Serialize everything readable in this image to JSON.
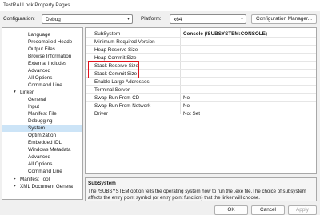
{
  "window": {
    "title": "TestRAIILock Property Pages"
  },
  "config": {
    "configuration_label": "Configuration:",
    "configuration_value": "Debug",
    "platform_label": "Platform:",
    "platform_value": "x64",
    "manager_button": "Configuration Manager..."
  },
  "tree": {
    "items": [
      {
        "label": "Language"
      },
      {
        "label": "Precompiled Heade"
      },
      {
        "label": "Output Files"
      },
      {
        "label": "Browse Information"
      },
      {
        "label": "External Includes"
      },
      {
        "label": "Advanced"
      },
      {
        "label": "All Options"
      },
      {
        "label": "Command Line"
      },
      {
        "label": "Linker",
        "expander": "▾"
      },
      {
        "label": "General"
      },
      {
        "label": "Input"
      },
      {
        "label": "Manifest File"
      },
      {
        "label": "Debugging"
      },
      {
        "label": "System",
        "selected": true
      },
      {
        "label": "Optimization"
      },
      {
        "label": "Embedded IDL"
      },
      {
        "label": "Windows Metadata"
      },
      {
        "label": "Advanced"
      },
      {
        "label": "All Options"
      },
      {
        "label": "Command Line"
      },
      {
        "label": "Manifest Tool",
        "expander": "▸"
      },
      {
        "label": "XML Document Genera",
        "expander": "▸"
      }
    ]
  },
  "grid": {
    "rows": [
      {
        "name": "SubSystem",
        "value": "Console (/SUBSYSTEM:CONSOLE)",
        "bold": true
      },
      {
        "name": "Minimum Required Version",
        "value": ""
      },
      {
        "name": "Heap Reserve Size",
        "value": ""
      },
      {
        "name": "Heap Commit Size",
        "value": ""
      },
      {
        "name": "Stack Reserve Size",
        "value": ""
      },
      {
        "name": "Stack Commit Size",
        "value": ""
      },
      {
        "name": "Enable Large Addresses",
        "value": ""
      },
      {
        "name": "Terminal Server",
        "value": ""
      },
      {
        "name": "Swap Run From CD",
        "value": "No"
      },
      {
        "name": "Swap Run From Network",
        "value": "No"
      },
      {
        "name": "Driver",
        "value": "Not Set"
      }
    ]
  },
  "description": {
    "title": "SubSystem",
    "text": "The /SUBSYSTEM option tells the operating system how to run the .exe file.The choice of subsystem affects the entry point symbol (or entry point function) that the linker will choose."
  },
  "buttons": {
    "ok": "OK",
    "cancel": "Cancel",
    "apply": "Apply"
  }
}
